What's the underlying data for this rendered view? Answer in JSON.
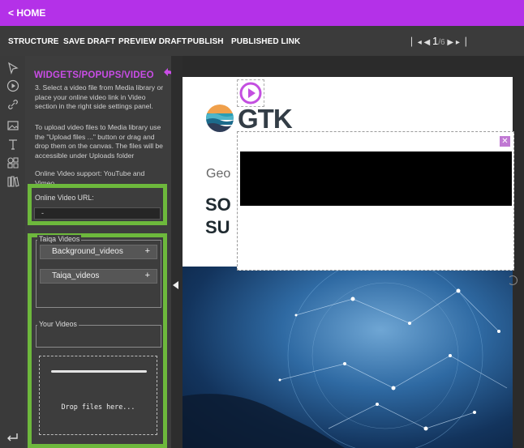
{
  "topbar": {
    "home_label": "< HOME"
  },
  "menu": {
    "structure": "STRUCTURE",
    "save_draft": "SAVE DRAFT",
    "preview_draft": "PREVIEW DRAFT",
    "publish": "PUBLISH",
    "published_link": "PUBLISHED LINK"
  },
  "pager": {
    "current": "1",
    "total": "6",
    "separator": "/"
  },
  "toolbar": {
    "tools": [
      "pointer-icon",
      "play-circle-icon",
      "link-icon",
      "image-icon",
      "text-icon",
      "shapes-icon",
      "library-icon"
    ]
  },
  "panel": {
    "title": "WIDGETS/POPUPS/VIDEO",
    "help_1": "3. Select a video file from Media library or place your online video link in Video section in the right side settings panel.",
    "help_2": "To upload video files to Media library use the \"Upload files ...\" button or drag and drop them on the canvas. The files will be accessible under Uploads folder",
    "help_3": "Online Video support: YouTube and Vimeo",
    "url_label": "Online Video URL:",
    "url_value": "-",
    "taiqa_legend": "Taiqa Videos",
    "folders": [
      "Background_videos",
      "Taiqa_videos"
    ],
    "your_videos_legend": "Your Videos",
    "drop_text": "Drop files here..."
  },
  "slide": {
    "logo_text": "GTK",
    "subtitle_partial": "Geo",
    "heading_line1": "SO",
    "heading_line2": "SU"
  },
  "colors": {
    "accent": "#b431e8",
    "highlight": "#6db83c",
    "title": "#c94de6"
  }
}
